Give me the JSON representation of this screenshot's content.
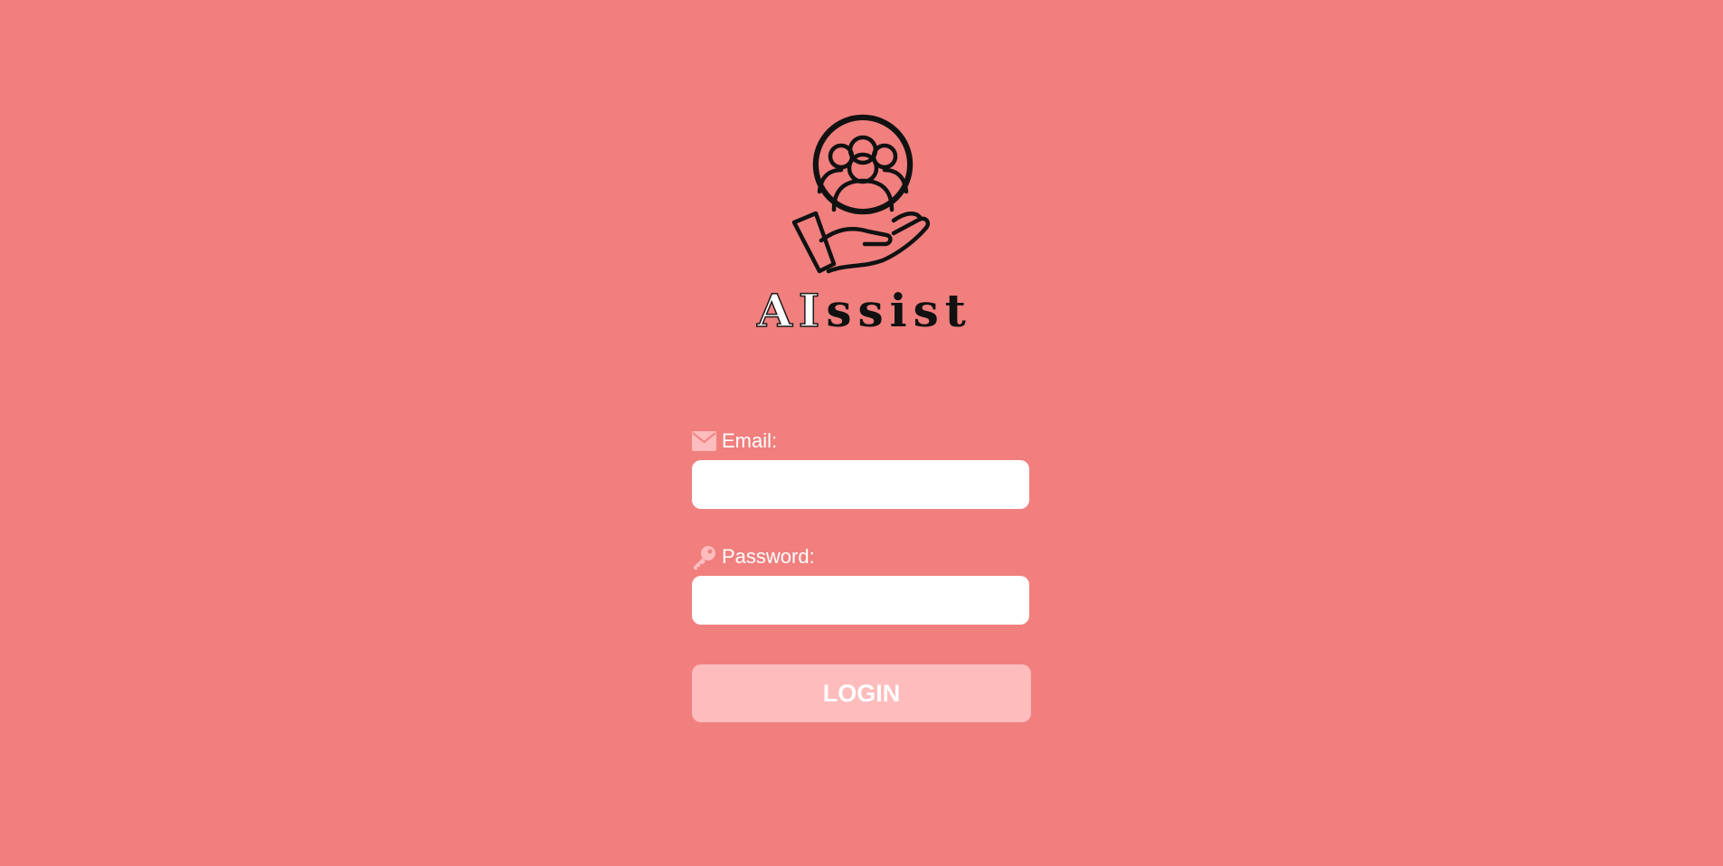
{
  "brand": {
    "name_highlight": "AI",
    "name_rest": "ssist",
    "logo_icon": "people-in-hand-icon"
  },
  "form": {
    "email": {
      "label": "Email:",
      "icon": "envelope-icon",
      "value": "",
      "placeholder": ""
    },
    "password": {
      "label": "Password:",
      "icon": "key-icon",
      "value": "",
      "placeholder": ""
    },
    "login_label": "LOGIN"
  },
  "colors": {
    "background": "#f07f7e",
    "button": "#ffbcbd",
    "icon": "#ffbcbd",
    "input": "#ffffff",
    "text": "#ffffff"
  }
}
